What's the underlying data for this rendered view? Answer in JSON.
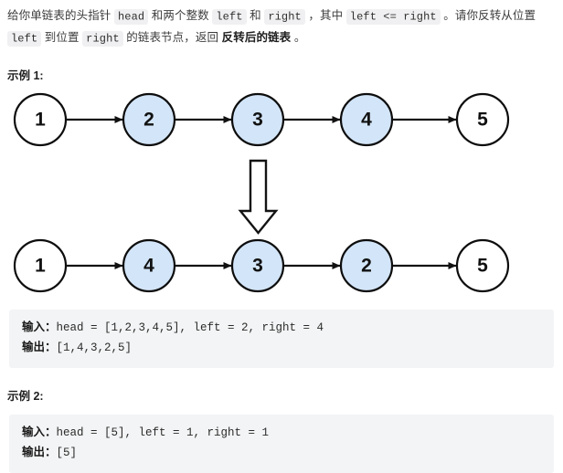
{
  "statement": {
    "seg1": "给你单链表的头指针 ",
    "code1": "head",
    "seg2": " 和两个整数 ",
    "code2": "left",
    "seg3": " 和 ",
    "code3": "right",
    "seg4": " ，其中 ",
    "code4": "left <= right",
    "seg5": " 。请你反转从位置 ",
    "code5": "left",
    "seg6": " 到位置 ",
    "code6": "right",
    "seg7": " 的链表节点，返回 ",
    "bold1": "反转后的链表",
    "seg8": " 。"
  },
  "examples": [
    {
      "title": "示例 1:",
      "input_label": "输入：",
      "input_value": "head = [1,2,3,4,5], left = 2, right = 4",
      "output_label": "输出：",
      "output_value": "[1,4,3,2,5]"
    },
    {
      "title": "示例 2:",
      "input_label": "输入：",
      "input_value": "head = [5], left = 1, right = 1",
      "output_label": "输出：",
      "output_value": "[5]"
    }
  ],
  "figure": {
    "before_nodes": [
      {
        "value": "1",
        "highlighted": false
      },
      {
        "value": "2",
        "highlighted": true
      },
      {
        "value": "3",
        "highlighted": true
      },
      {
        "value": "4",
        "highlighted": true
      },
      {
        "value": "5",
        "highlighted": false
      }
    ],
    "after_nodes": [
      {
        "value": "1",
        "highlighted": false
      },
      {
        "value": "4",
        "highlighted": true
      },
      {
        "value": "3",
        "highlighted": true
      },
      {
        "value": "2",
        "highlighted": true
      },
      {
        "value": "5",
        "highlighted": false
      }
    ],
    "transform_arrow": "down-arrow",
    "colors": {
      "node_highlight_fill": "#d3e5f8",
      "node_plain_fill": "#ffffff",
      "node_stroke": "#0d0d0d",
      "arrow": "#111111"
    }
  }
}
